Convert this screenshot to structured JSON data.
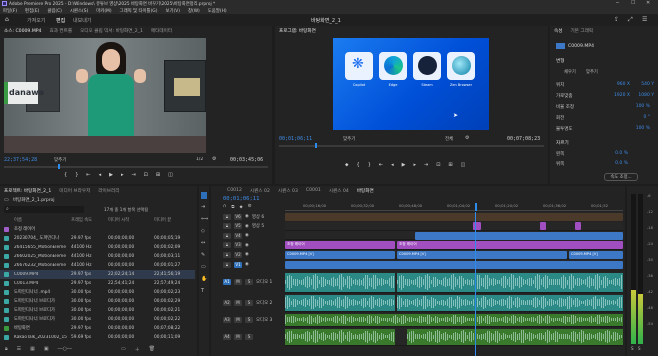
{
  "window": {
    "title": "Adobe Premiere Pro 2025 - D:\\Windows\\ 유튜브 영상\\2025 바탕화면 바꾸기\\2025\\바탕화면정리.prproj *"
  },
  "menubar": [
    "파일(F)",
    "편집(E)",
    "클립(C)",
    "시퀀스(S)",
    "마커(M)",
    "그래픽 및 타이틀(G)",
    "보기(V)",
    "창(W)",
    "도움말(H)"
  ],
  "topnav": {
    "tabs": [
      "가져오기",
      "편집",
      "내보내기"
    ],
    "active": 1,
    "center_title": "바탕화면_2_1"
  },
  "source_monitor": {
    "tabs": [
      "소스: C0009.MP4",
      "효과 컨트롤",
      "오디오 클립 믹서: 바탕화면_2_1",
      "메타데이터"
    ],
    "timecode": "22;37;54;28",
    "fit": "맞추기",
    "ratio": "1/2",
    "duration": "00;03;45;06",
    "logo_text": "danawa"
  },
  "program_monitor": {
    "tab": "프로그램: 바탕화면",
    "timecode": "00;01;06;11",
    "fit": "맞추기",
    "quality": "전체",
    "duration": "00;07;08;23",
    "desktop_icons": [
      "Copilot",
      "Edge",
      "Steam",
      "Zen Browser"
    ]
  },
  "effects_panel": {
    "tabs": [
      "속성",
      "기본 그래픽"
    ],
    "clip_name": "C0009.MP4",
    "section_transform": "변형",
    "fit_buttons": [
      "채우기",
      "맞추기"
    ],
    "rows": [
      {
        "label": "위치",
        "value": "960 X",
        "value2": "540 Y"
      },
      {
        "label": "가로맞춤",
        "value": "1920 X",
        "value2": "1080 Y"
      },
      {
        "label": "비율 조정",
        "value": "100 %"
      },
      {
        "label": "회전",
        "value": "0 °"
      },
      {
        "label": "불투명도",
        "value": "100 %"
      }
    ],
    "section_crop": "자르기",
    "crop_rows": [
      {
        "label": "왼쪽",
        "value": "0.0 %"
      },
      {
        "label": "위쪽",
        "value": "0.0 %"
      }
    ],
    "button_label": "속도 조정..."
  },
  "project_panel": {
    "tabs": [
      "프로젝트: 바탕화면_2_1",
      "미디어 브라우저",
      "라이브러리"
    ],
    "project_file": "바탕화면_2_1.prproj",
    "item_count": "17개 중 1개 항목 선택됨",
    "columns": [
      "이름",
      "프레임 속도",
      "미디어 시작",
      "미디어 끝"
    ],
    "items": [
      {
        "name": "조정 레이어",
        "fps": "",
        "start": "",
        "end": "",
        "color": "#a25ec9"
      },
      {
        "name": "20230704_ 도파민디나",
        "fps": "29.97 fps",
        "start": "00;00;00;00",
        "end": "00;00;05;19",
        "color": "#3ba8a6"
      },
      {
        "name": "26415655_MotionEleme",
        "fps": "44100 Hz",
        "start": "00;00;00;00",
        "end": "00;00;02;09",
        "color": "#3ba8a6"
      },
      {
        "name": "26602025_MotionEleme",
        "fps": "44100 Hz",
        "start": "00;00;00;00",
        "end": "00;00;03;11",
        "color": "#3ba8a6"
      },
      {
        "name": "26676232_MotionEleme",
        "fps": "44100 Hz",
        "start": "00;00;00;00",
        "end": "00;00;01;27",
        "color": "#3ba8a6"
      },
      {
        "name": "C0009.MP4",
        "fps": "29.97 fps",
        "start": "22;02;24;14",
        "end": "22;41;56;19",
        "color": "#3ba8a6"
      },
      {
        "name": "C0013.MP4",
        "fps": "29.97 fps",
        "start": "22;54;41;24",
        "end": "22;57;49;24",
        "color": "#3ba8a6"
      },
      {
        "name": "도파민디나너 .mp4",
        "fps": "30.00 fps",
        "start": "00;00;00;00",
        "end": "00;00;02;23",
        "color": "#3ba8a6"
      },
      {
        "name": "도파민디나너 브로디가",
        "fps": "30.00 fps",
        "start": "00;00;00;00",
        "end": "00;00;02;29",
        "color": "#3ba8a6"
      },
      {
        "name": "도파민디나너 브로디가",
        "fps": "30.00 fps",
        "start": "00;00;00;00",
        "end": "00;00;02;21",
        "color": "#3ba8a6"
      },
      {
        "name": "도파민디나너 브로디가",
        "fps": "30.00 fps",
        "start": "00;00;00;00",
        "end": "00;00;02;22",
        "color": "#3ba8a6"
      },
      {
        "name": "바탕화면",
        "fps": "29.97 fps",
        "start": "00;00;00;00",
        "end": "00;07;08;22",
        "color": "#3c9a3c"
      },
      {
        "name": "KakaoTalk_20231002_15",
        "fps": "59.69 fps",
        "start": "00;00;00;00",
        "end": "00;00;11;09",
        "color": "#3ba8a6"
      }
    ]
  },
  "timeline": {
    "tabs": [
      "C0012",
      "시퀀스 02",
      "시퀀스 03",
      "C0001",
      "시퀀스 04",
      "바탕화면"
    ],
    "active_tab": 5,
    "timecode": "00;01;06;11",
    "ruler": [
      "00;00;16;00",
      "00;00;32;00",
      "00;00;48;00",
      "00;01;04;02",
      "00;01;20;02",
      "00;01;36;02",
      "00;01;52"
    ],
    "video_tracks": [
      "V6",
      "V5",
      "V4",
      "V3",
      "V2",
      "V1"
    ],
    "audio_tracks": [
      "A1",
      "A2",
      "A3",
      "A4"
    ],
    "track_labels": {
      "V6": "영상 6",
      "V5": "영상 5",
      "A1": "오디오 1",
      "A2": "오디오 2",
      "A3": "오디오 3"
    },
    "clip_labels": [
      "조정 레이어",
      "조정 레이어",
      "C0009.MP4 [V]",
      "C0009.MP4 [V]",
      "C0009.MP4 [V]"
    ],
    "meter_labels": [
      "-6",
      "-12",
      "-18",
      "-24",
      "-30",
      "-36",
      "-42",
      "-48",
      "-54"
    ]
  },
  "colors": {
    "accent": "#2d8ceb",
    "clip_purple": "#a04ec0",
    "clip_blue": "#3d78c6",
    "clip_audio": "#2b8a85",
    "clip_green": "#3a7a2c"
  }
}
